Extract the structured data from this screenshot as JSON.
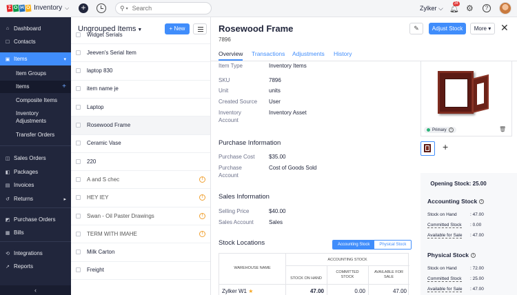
{
  "topbar": {
    "logo_letters": [
      "Z",
      "O",
      "H",
      "O"
    ],
    "logo_colors": [
      "#e42527",
      "#089949",
      "#226db4",
      "#f9b21d"
    ],
    "app_name": "Inventory",
    "search_placeholder": "Search",
    "org_name": "Zylker",
    "notification_count": "34"
  },
  "sidebar": {
    "items": [
      {
        "label": "Dashboard",
        "icon": "dashboard-icon"
      },
      {
        "label": "Contacts",
        "icon": "contacts-icon"
      },
      {
        "label": "Items",
        "icon": "items-icon"
      },
      {
        "label": "Sales Orders",
        "icon": "sales-orders-icon"
      },
      {
        "label": "Packages",
        "icon": "packages-icon"
      },
      {
        "label": "Invoices",
        "icon": "invoices-icon"
      },
      {
        "label": "Returns",
        "icon": "returns-icon"
      },
      {
        "label": "Purchase Orders",
        "icon": "purchase-orders-icon"
      },
      {
        "label": "Bills",
        "icon": "bills-icon"
      },
      {
        "label": "Integrations",
        "icon": "integrations-icon"
      },
      {
        "label": "Reports",
        "icon": "reports-icon"
      }
    ],
    "subitems": {
      "item_groups": "Item Groups",
      "items": "Items",
      "composite_items": "Composite Items",
      "inventory_adjustments_line1": "Inventory",
      "inventory_adjustments_line2": "Adjustments",
      "transfer_orders": "Transfer Orders"
    }
  },
  "list": {
    "title": "Ungrouped Items",
    "new_label": "New",
    "rows": [
      {
        "name": "Widget Serials",
        "warn": false
      },
      {
        "name": "Jeeven's Serial Item",
        "warn": false
      },
      {
        "name": "laptop 830",
        "warn": false
      },
      {
        "name": "item name je",
        "warn": false
      },
      {
        "name": "Laptop",
        "warn": false
      },
      {
        "name": "Rosewood Frame",
        "warn": false,
        "selected": true
      },
      {
        "name": "Ceramic Vase",
        "warn": false
      },
      {
        "name": "220",
        "warn": false
      },
      {
        "name": "A and S chec",
        "warn": true
      },
      {
        "name": "HEY IEY",
        "warn": true
      },
      {
        "name": "Swan - Oil Paster Drawings",
        "warn": true
      },
      {
        "name": "TERM WITH IMAHE",
        "warn": true
      },
      {
        "name": "Milk Carton",
        "warn": false
      },
      {
        "name": "Freight",
        "warn": false
      }
    ]
  },
  "detail": {
    "title": "Rosewood Frame",
    "sku_sub": "7896",
    "adjust_stock": "Adjust Stock",
    "more": "More",
    "tabs": [
      "Overview",
      "Transactions",
      "Adjustments",
      "History"
    ],
    "overview": {
      "item_type_label": "Item Type",
      "item_type": "Inventory Items",
      "sku_label": "SKU",
      "sku": "7896",
      "unit_label": "Unit",
      "unit": "units",
      "created_source_label": "Created Source",
      "created_source": "User",
      "inventory_account_label_1": "Inventory",
      "inventory_account_label_2": "Account",
      "inventory_account": "Inventory Asset"
    },
    "purchase": {
      "title": "Purchase Information",
      "cost_label": "Purchase Cost",
      "cost": "$35.00",
      "account_label_1": "Purchase",
      "account_label_2": "Account",
      "account": "Cost of Goods Sold"
    },
    "sales": {
      "title": "Sales Information",
      "price_label": "Selling Price",
      "price": "$40.00",
      "account_label": "Sales Account",
      "account": "Sales"
    },
    "image": {
      "primary_label": "Primary"
    },
    "stock": {
      "opening": "Opening Stock: 25.00",
      "accounting_title": "Accounting Stock",
      "accounting": [
        {
          "label": "Stock on Hand",
          "value": ": 47.00",
          "underline": false
        },
        {
          "label": "Committed Stock",
          "value": ": 0.00",
          "underline": true
        },
        {
          "label": "Available for Sale",
          "value": ": 47.00",
          "underline": true
        }
      ],
      "physical_title": "Physical Stock",
      "physical": [
        {
          "label": "Stock on Hand",
          "value": ": 72.00",
          "underline": false
        },
        {
          "label": "Committed Stock",
          "value": ": 25.00",
          "underline": true
        },
        {
          "label": "Available for Sale",
          "value": ": 47.00",
          "underline": true
        }
      ]
    },
    "locations": {
      "title": "Stock Locations",
      "toggle_on": "Accounting Stock",
      "toggle_off": "Physical Stock",
      "col_warehouse": "WAREHOUSE NAME",
      "col_group": "ACCOUNTING STOCK",
      "col_on_hand": "STOCK ON HAND",
      "col_committed_1": "COMMITTED",
      "col_committed_2": "STOCK",
      "col_available_1": "AVAILABLE FOR",
      "col_available_2": "SALE",
      "rows": [
        {
          "warehouse": "Zylker W1",
          "on_hand": "47.00",
          "committed": "0.00",
          "available": "47.00"
        }
      ]
    }
  }
}
